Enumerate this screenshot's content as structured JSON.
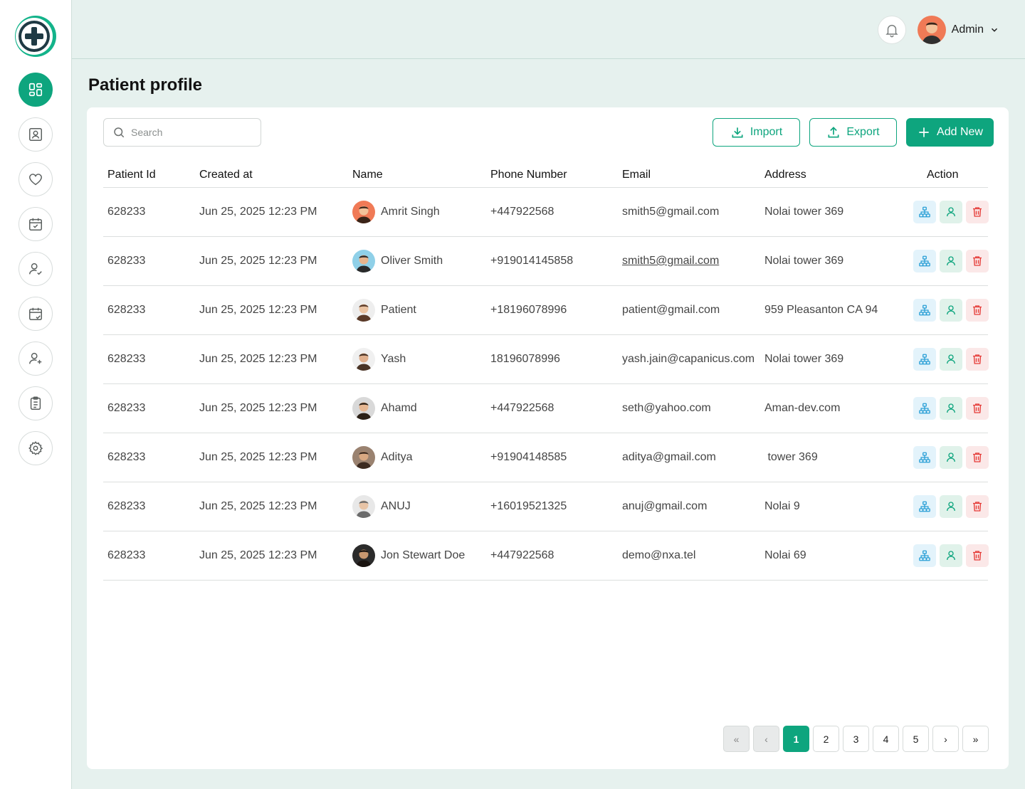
{
  "header": {
    "user_name": "Admin"
  },
  "page": {
    "title": "Patient profile"
  },
  "search": {
    "placeholder": "Search"
  },
  "toolbar": {
    "import_label": "Import",
    "export_label": "Export",
    "add_label": "Add New"
  },
  "table": {
    "columns": [
      "Patient Id",
      "Created at",
      "Name",
      "Phone Number",
      "Email",
      "Address",
      "Action"
    ],
    "rows": [
      {
        "id": "628233",
        "created": "Jun 25, 2025 12:23 PM",
        "name": "Amrit Singh",
        "phone": "+447922568",
        "email": "smith5@gmail.com",
        "address": "Nolai tower 369"
      },
      {
        "id": "628233",
        "created": "Jun 25, 2025 12:23 PM",
        "name": "Oliver Smith",
        "phone": "+919014145858",
        "email": "smith5@gmail.com",
        "address": "Nolai tower 369"
      },
      {
        "id": "628233",
        "created": "Jun 25, 2025 12:23 PM",
        "name": "Patient",
        "phone": "+18196078996",
        "email": "patient@gmail.com",
        "address": "959 Pleasanton CA 94"
      },
      {
        "id": "628233",
        "created": "Jun 25, 2025 12:23 PM",
        "name": "Yash",
        "phone": "18196078996",
        "email": "yash.jain@capanicus.com",
        "address": "Nolai tower 369"
      },
      {
        "id": "628233",
        "created": "Jun 25, 2025 12:23 PM",
        "name": "Ahamd",
        "phone": "+447922568",
        "email": "seth@yahoo.com",
        "address": "Aman-dev.com"
      },
      {
        "id": "628233",
        "created": "Jun 25, 2025 12:23 PM",
        "name": "Aditya",
        "phone": "+91904148585",
        "email": "aditya@gmail.com",
        "address": " tower 369"
      },
      {
        "id": "628233",
        "created": "Jun 25, 2025 12:23 PM",
        "name": "ANUJ",
        "phone": "+16019521325",
        "email": "anuj@gmail.com",
        "address": "Nolai 9"
      },
      {
        "id": "628233",
        "created": "Jun 25, 2025 12:23 PM",
        "name": "Jon Stewart Doe",
        "phone": "+447922568",
        "email": "demo@nxa.tel",
        "address": "Nolai 69"
      }
    ]
  },
  "pagination": {
    "first": "«",
    "prev": "‹",
    "pages": [
      "1",
      "2",
      "3",
      "4",
      "5"
    ],
    "current": "1",
    "next": "›",
    "last": "»"
  },
  "colors": {
    "accent": "#0ea57e",
    "background": "#e6f1ee",
    "delete": "#e53935",
    "tree": "#2a9fd6"
  },
  "icons": {
    "sidebar": [
      "dashboard-icon",
      "contact-card-icon",
      "heart-icon",
      "calendar-check-icon",
      "user-check-icon",
      "calendar-check-icon",
      "user-add-icon",
      "clipboard-list-icon",
      "gear-icon"
    ],
    "row_actions": [
      "hierarchy-icon",
      "user-icon",
      "trash-icon"
    ]
  }
}
